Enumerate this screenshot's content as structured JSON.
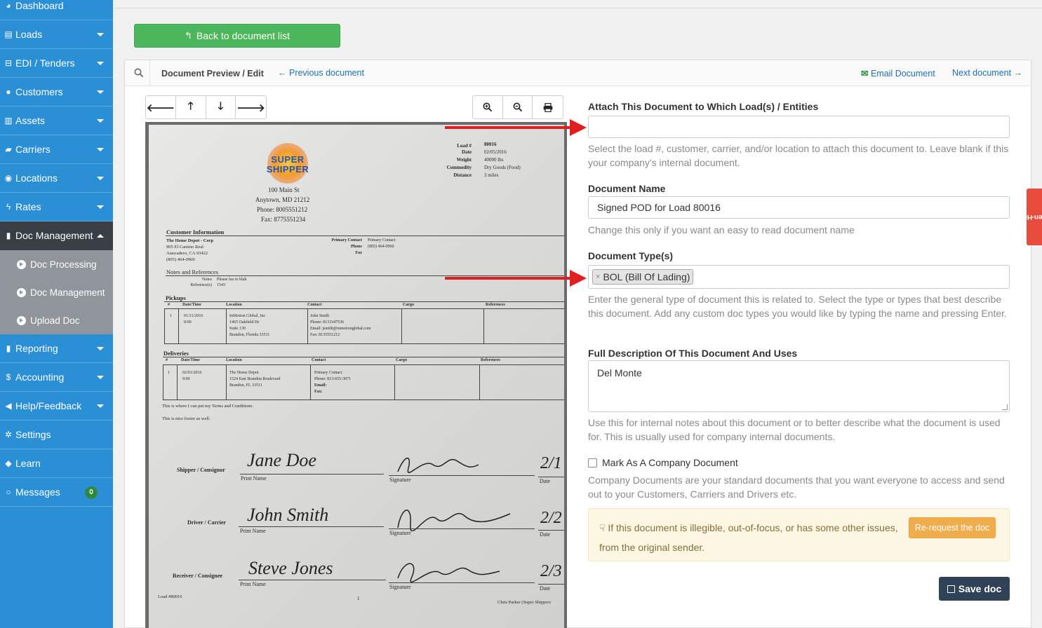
{
  "sidebar": {
    "items": [
      {
        "label": "Dashboard",
        "icon": "dashboard-icon"
      },
      {
        "label": "Loads",
        "icon": "list-icon"
      },
      {
        "label": "EDI / Tenders",
        "icon": "inbox-icon"
      },
      {
        "label": "Customers",
        "icon": "users-icon"
      },
      {
        "label": "Assets",
        "icon": "barcode-icon"
      },
      {
        "label": "Carriers",
        "icon": "truck-icon"
      },
      {
        "label": "Locations",
        "icon": "map-marker-icon"
      },
      {
        "label": "Rates",
        "icon": "bolt-icon"
      },
      {
        "label": "Doc Management",
        "icon": "file-icon"
      },
      {
        "label": "Reporting",
        "icon": "report-icon"
      },
      {
        "label": "Accounting",
        "icon": "dollar-icon"
      },
      {
        "label": "Help/Feedback",
        "icon": "bullhorn-icon"
      },
      {
        "label": "Settings",
        "icon": "cogs-icon"
      },
      {
        "label": "Learn",
        "icon": "graduation-cap-icon"
      },
      {
        "label": "Messages",
        "icon": "comment-icon",
        "badge": "0"
      }
    ],
    "subitems": [
      "Doc Processing",
      "Doc Management",
      "Upload Doc"
    ]
  },
  "back_button": "Back to document list",
  "panel": {
    "title": "Document Preview / Edit",
    "prev_link": "Previous document",
    "email_link": "Email Document",
    "next_link": "Next document"
  },
  "document": {
    "address": [
      "100 Main St",
      "Anytown, MD 21212",
      "Phone: 8005551212",
      "Fax: 8775551234"
    ],
    "logo_lines": [
      "SUPER",
      "SHIPPER"
    ],
    "load_keys": [
      "Load #",
      "Date",
      "Weight",
      "Commodity",
      "Distance"
    ],
    "load_vals": [
      "80016",
      "02/05/2016",
      "40000 lbs",
      "Dry Goods (Food)",
      "3 miles"
    ],
    "customer_heading": "Customer Information",
    "customer_lines": [
      "The Home Depot - Corp",
      "905 El Camino Real",
      "Atascadero, CA 93422",
      "(805) 464-0960"
    ],
    "contact_keys": [
      "Primary Contact",
      "Phone",
      "Fax"
    ],
    "contact_vals": [
      "Primary Contact",
      "(805) 464-0960",
      ""
    ],
    "notes_heading": "Notes and References",
    "notes_keys": [
      "Notes",
      "Reference(s)"
    ],
    "notes_vals": [
      "Please fax to blah",
      "1543"
    ],
    "pickups_heading": "Pickups",
    "deliveries_heading": "Deliveries",
    "table_headers": [
      "#",
      "Date/Time",
      "Location",
      "Contact",
      "Cargo",
      "References"
    ],
    "pickup": {
      "num": "1",
      "date": "01/31/2016",
      "time": "8:00",
      "loc": [
        "InMotion Global, Inc",
        "1465 Oakfield Dr",
        "Suite 139",
        "Brandon, Florida 33511"
      ],
      "contact": [
        "John Smith",
        "Phone: 8133347536",
        "Email: jsmith@inmotionglobal.com",
        "Fax: 8135551212"
      ]
    },
    "delivery": {
      "num": "1",
      "date": "02/01/2016",
      "time": "9:00",
      "loc": [
        "The Home Depot",
        "1524 East Brandon Boulevard",
        "Brandon, FL 33511"
      ],
      "contact": [
        "Primary Contact",
        "Phone: 813-655-3871",
        "Email:",
        "Fax:"
      ]
    },
    "terms": "This is where I can put my Terms and Conditions.",
    "footer_note": "This is nice footer as well.",
    "sig_rows": [
      {
        "role": "Shipper / Consignor",
        "name": "Jane Doe",
        "date": "2/1"
      },
      {
        "role": "Driver / Carrier",
        "name": "John Smith",
        "date": "2/2"
      },
      {
        "role": "Receiver / Consignee",
        "name": "Steve Jones",
        "date": "2/3"
      }
    ],
    "print_name": "Print Name",
    "signature": "Signature",
    "date_label": "Date",
    "load_footer": "Load #80016",
    "page_mark": "1",
    "footer_right": "Chris Parker (Super Shippers"
  },
  "form": {
    "attach_label": "Attach This Document to Which Load(s) / Entities",
    "attach_value": "",
    "attach_help": "Select the load #, customer, carrier, and/or location to attach this document to. Leave blank if this your company's internal document.",
    "name_label": "Document Name",
    "name_value": "Signed POD for Load 80016",
    "name_help": "Change this only if you want an easy to read document name",
    "type_label": "Document Type(s)",
    "type_tag": "BOL (Bill Of Lading)",
    "type_help": "Enter the general type of document this is related to. Select the type or types that best describe this document. Add any custom doc types you would like by typing the name and pressing Enter.",
    "desc_label": "Full Description Of This Document And Uses",
    "desc_value": "Del Monte",
    "desc_help": "Use this for internal notes about this document or to better describe what the document is used for. This is usually used for company internal documents.",
    "company_doc_label": "Mark As A Company Document",
    "company_doc_help": "Company Documents are your standard documents that you want everyone to access and send out to your Customers, Carriers and Drivers etc.",
    "warn_text1": "If this document is illegible, out-of-focus, or has some other issues,",
    "warn_button": "Re-request the doc",
    "warn_text2": "from the original sender.",
    "save_button": "Save doc"
  },
  "open_help": "Open Help",
  "colors": {
    "sidebar": "#2b8fd6",
    "active": "#3a3f45",
    "green": "#4cb75c",
    "warning": "#f0ad4e",
    "save": "#2f4256",
    "arrow": "#e02020"
  }
}
